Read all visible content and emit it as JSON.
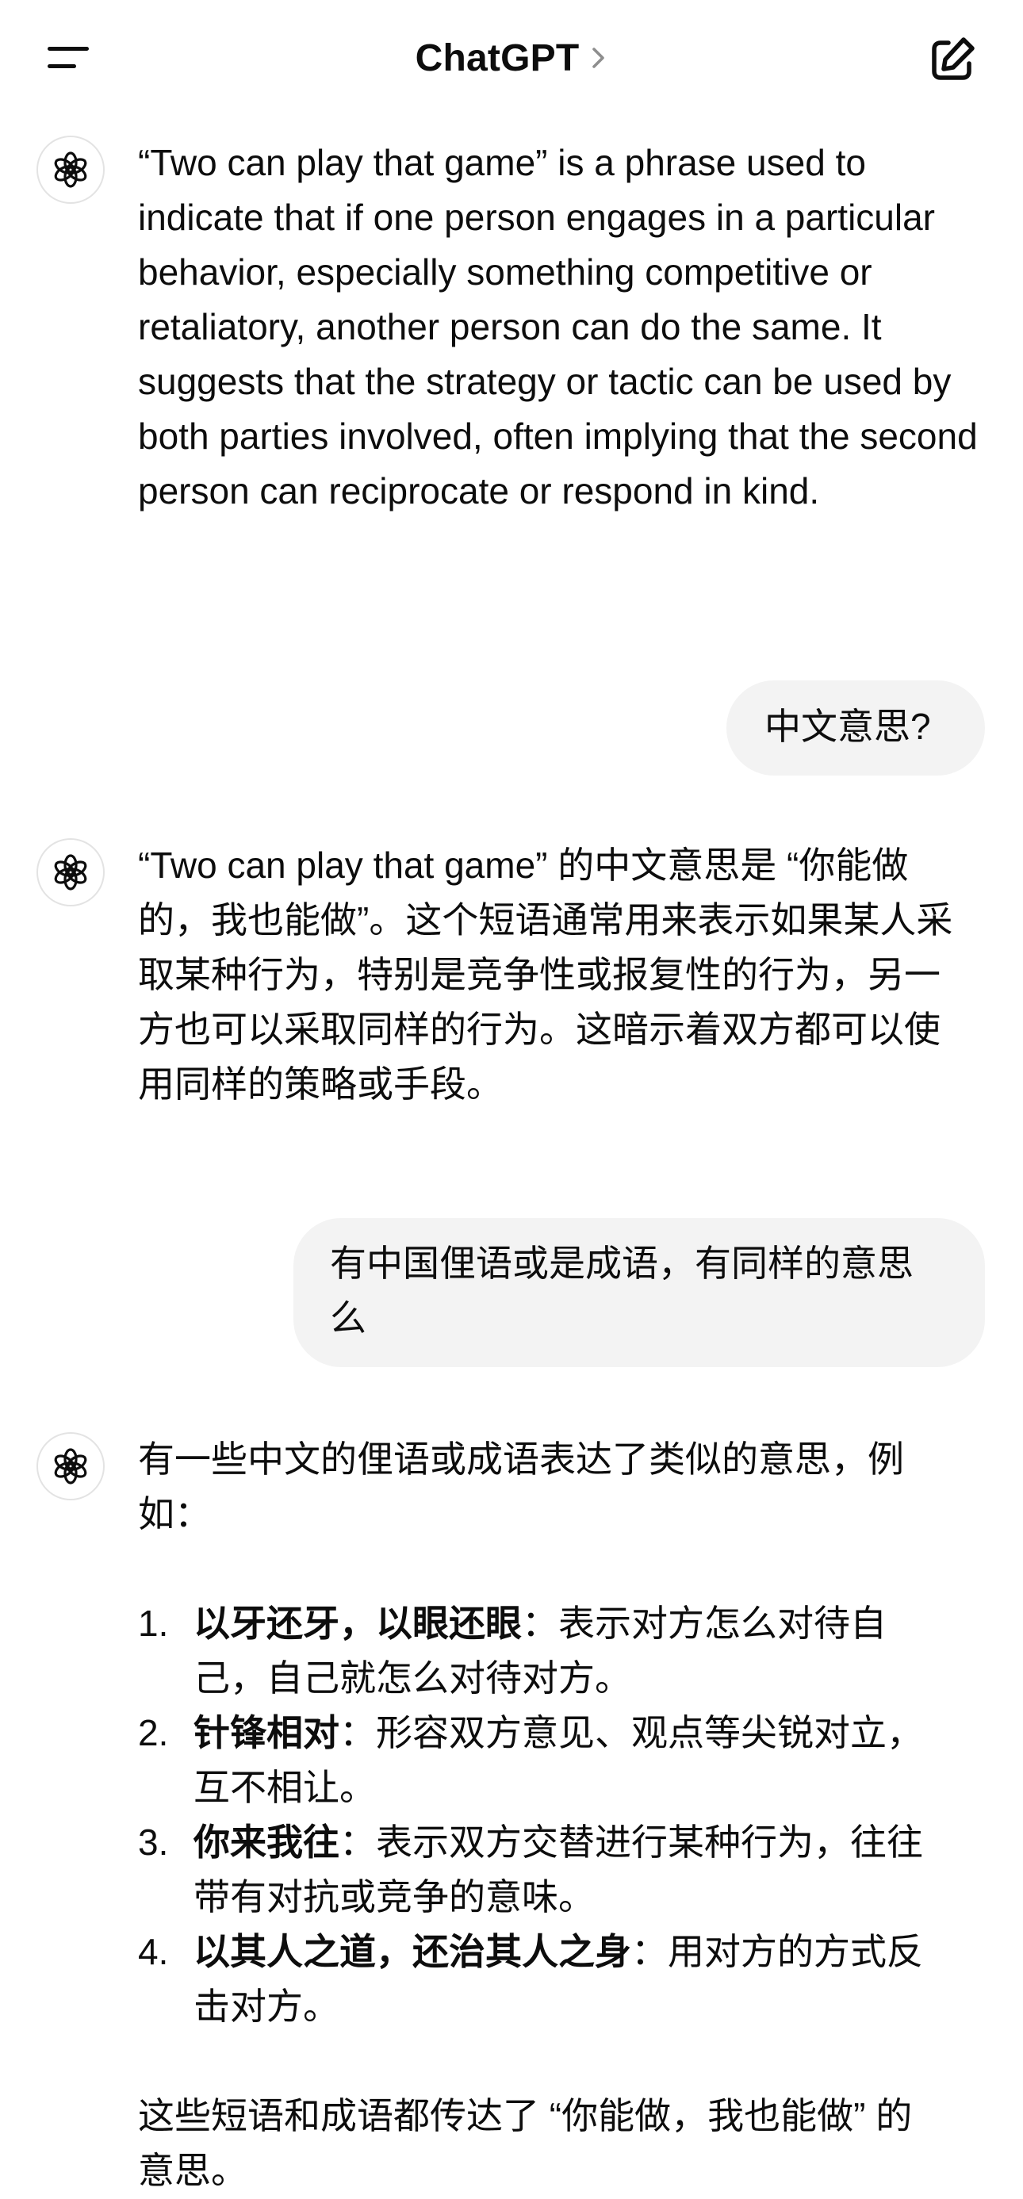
{
  "header": {
    "title": "ChatGPT",
    "menu_icon": "hamburger-menu-icon",
    "chevron_icon": "chevron-right-icon",
    "compose_icon": "new-chat-edit-icon"
  },
  "messages": {
    "a1": {
      "text": "“Two can play that game” is a phrase used to indicate that if one person engages in a particular behavior, especially something competitive or retaliatory, another person can do the same. It suggests that the strategy or tactic can be used by both parties involved, often implying that the second person can reciprocate or respond in kind."
    },
    "u1": {
      "text": "中文意思?"
    },
    "a2": {
      "text": "“Two can play that game” 的中文意思是 “你能做的，我也能做”。这个短语通常用来表示如果某人采取某种行为，特别是竞争性或报复性的行为，另一方也可以采取同样的行为。这暗示着双方都可以使用同样的策略或手段。"
    },
    "u2": {
      "text": "有中国俚语或是成语，有同样的意思么"
    },
    "a3": {
      "intro": "有一些中文的俚语或成语表达了类似的意思，例如：",
      "items": [
        {
          "num": "1.",
          "term": "以牙还牙，以眼还眼",
          "desc": "：表示对方怎么对待自己，自己就怎么对待对方。"
        },
        {
          "num": "2.",
          "term": "针锋相对",
          "desc": "：形容双方意见、观点等尖锐对立，互不相让。"
        },
        {
          "num": "3.",
          "term": "你来我往",
          "desc": "：表示双方交替进行某种行为，往往带有对抗或竞争的意味。"
        },
        {
          "num": "4.",
          "term": "以其人之道，还治其人之身",
          "desc": "：用对方的方式反击对方。"
        }
      ],
      "outro": "这些短语和成语都传达了 “你能做，我也能做” 的意思。"
    }
  },
  "avatar_icon": "openai-logo-icon"
}
